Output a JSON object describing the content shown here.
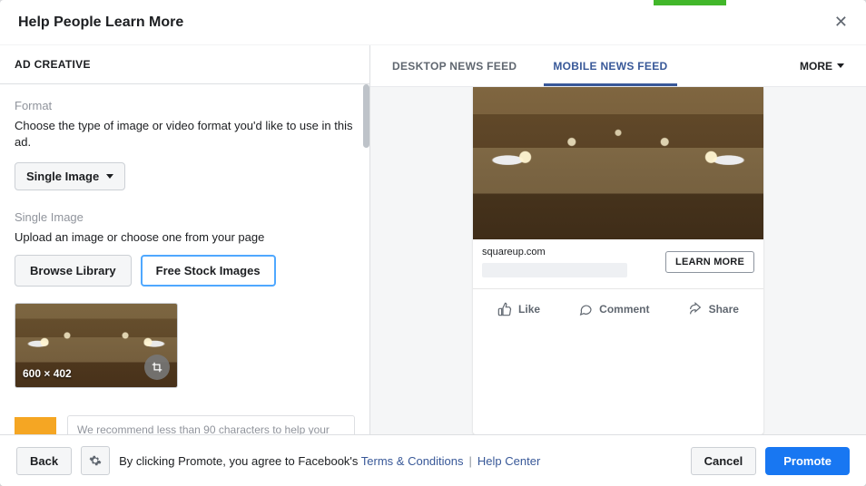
{
  "header": {
    "title": "Help People Learn More"
  },
  "left": {
    "panel_title": "AD CREATIVE",
    "format_label": "Format",
    "format_desc": "Choose the type of image or video format you'd like to use in this ad.",
    "format_value": "Single Image",
    "single_image_label": "Single Image",
    "single_image_desc": "Upload an image or choose one from your page",
    "browse_btn": "Browse Library",
    "stock_btn": "Free Stock Images",
    "thumb_dim": "600 × 402",
    "recommend": "We recommend less than 90 characters to help your"
  },
  "tabs": {
    "desktop": "DESKTOP NEWS FEED",
    "mobile": "MOBILE NEWS FEED",
    "more": "MORE"
  },
  "preview": {
    "domain": "squareup.com",
    "cta": "LEARN MORE",
    "like": "Like",
    "comment": "Comment",
    "share": "Share"
  },
  "footer": {
    "back": "Back",
    "agree_pre": "By clicking Promote, you agree to Facebook's ",
    "terms": "Terms & Conditions",
    "help": "Help Center",
    "cancel": "Cancel",
    "promote": "Promote"
  }
}
